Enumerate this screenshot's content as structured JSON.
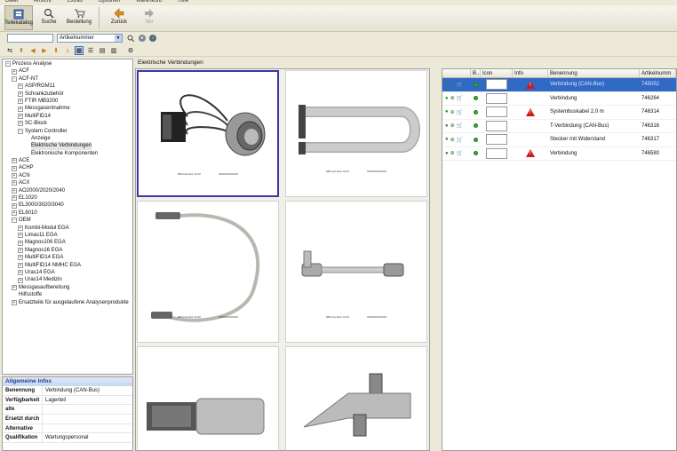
{
  "menu": [
    "Datei",
    "Ansicht",
    "Extras",
    "Optionen",
    "Warenkorb",
    "Hilfe"
  ],
  "toolbar": {
    "buttons": [
      {
        "label": "Teilekatalog",
        "icon": "catalog-icon"
      },
      {
        "label": "Suche",
        "icon": "search-icon"
      },
      {
        "label": "Bestellung",
        "icon": "cart-icon"
      },
      {
        "label": "Zurück",
        "icon": "back-arrow-icon"
      },
      {
        "label": "Vor",
        "icon": "forward-arrow-icon"
      }
    ]
  },
  "search": {
    "value": "",
    "field": "Artikelnummer"
  },
  "gallery": {
    "header": "Elektrische Verbindungen",
    "caption_left": "ABB Automation GmbH",
    "caption_right": "0000000000000000"
  },
  "tree": [
    {
      "label": "Prozess Analyse",
      "level": 0,
      "exp": "−"
    },
    {
      "label": "ACF",
      "level": 1,
      "exp": "+"
    },
    {
      "label": "ACF-NT",
      "level": 1,
      "exp": "−"
    },
    {
      "label": "ASP/RGM11",
      "level": 2,
      "exp": "+"
    },
    {
      "label": "Schrankzubehör",
      "level": 2,
      "exp": "+"
    },
    {
      "label": "FTIR MB3200",
      "level": 2,
      "exp": "+"
    },
    {
      "label": "Messgasentnahme",
      "level": 2,
      "exp": "+"
    },
    {
      "label": "MultiFID14",
      "level": 2,
      "exp": "+"
    },
    {
      "label": "SC-Block",
      "level": 2,
      "exp": "+"
    },
    {
      "label": "System Controller",
      "level": 2,
      "exp": "−"
    },
    {
      "label": "Anzeige",
      "level": 3,
      "exp": ""
    },
    {
      "label": "Elektrische Verbindungen",
      "level": 3,
      "exp": "",
      "selected": true
    },
    {
      "label": "Elektronische Komponenten",
      "level": 3,
      "exp": ""
    },
    {
      "label": "ACE",
      "level": 1,
      "exp": "+"
    },
    {
      "label": "ACHP",
      "level": 1,
      "exp": "+"
    },
    {
      "label": "ACN",
      "level": 1,
      "exp": "+"
    },
    {
      "label": "ACX",
      "level": 1,
      "exp": "+"
    },
    {
      "label": "AO2000/2020/2040",
      "level": 1,
      "exp": "+"
    },
    {
      "label": "EL1020",
      "level": 1,
      "exp": "+"
    },
    {
      "label": "EL3000/3020/3040",
      "level": 1,
      "exp": "+"
    },
    {
      "label": "EL6010",
      "level": 1,
      "exp": "+"
    },
    {
      "label": "OEM",
      "level": 1,
      "exp": "−"
    },
    {
      "label": "Kombi-Modul EGA",
      "level": 2,
      "exp": "+"
    },
    {
      "label": "Limas11 EGA",
      "level": 2,
      "exp": "+"
    },
    {
      "label": "Magnos106 EGA",
      "level": 2,
      "exp": "+"
    },
    {
      "label": "Magnos16 EGA",
      "level": 2,
      "exp": "+"
    },
    {
      "label": "MultiFID14 EGA",
      "level": 2,
      "exp": "+"
    },
    {
      "label": "MultiFID14 NMHC EGA",
      "level": 2,
      "exp": "+"
    },
    {
      "label": "Uras14 EGA",
      "level": 2,
      "exp": "+"
    },
    {
      "label": "Uras14 Medizin",
      "level": 2,
      "exp": "+"
    },
    {
      "label": "Messgasaufbereitung",
      "level": 1,
      "exp": "+"
    },
    {
      "label": "Hilfsstoffe",
      "level": 1,
      "exp": ""
    },
    {
      "label": "Ersatzteile für ausgelaufene Analysenprodukte",
      "level": 1,
      "exp": "+"
    }
  ],
  "info": {
    "title": "Allgemeine Infos",
    "rows": [
      {
        "key": "Benennung",
        "value": "Verbindung (CAN-Bus)"
      },
      {
        "key": "Verfügbarkeit",
        "value": "Lagerteil"
      },
      {
        "key": "alte",
        "value": ""
      },
      {
        "key": "Ersetzt durch",
        "value": ""
      },
      {
        "key": "Alternative",
        "value": ""
      },
      {
        "key": "Qualifikation",
        "value": "Wartungspersonal"
      }
    ]
  },
  "table": {
    "headers": [
      "",
      "B...",
      "Icon",
      "Info",
      "Benennung",
      "Artikelnumm"
    ],
    "rows": [
      {
        "name": "Verbindung (CAN-Bus)",
        "number": "745052",
        "info": true,
        "selected": true
      },
      {
        "name": "Verbindung",
        "number": "746264",
        "info": false
      },
      {
        "name": "Systembuskabel 2,0 m",
        "number": "746314",
        "info": true
      },
      {
        "name": "T-Verbindung (CAN-Bus)",
        "number": "746316",
        "info": false
      },
      {
        "name": "Stecker mit Widerstand",
        "number": "746317",
        "info": false
      },
      {
        "name": "Verbindung",
        "number": "746580",
        "info": true
      }
    ]
  },
  "colors": {
    "accent": "#316ac5",
    "status_green": "#2fb52f",
    "warning_red": "#cc1a1a"
  }
}
